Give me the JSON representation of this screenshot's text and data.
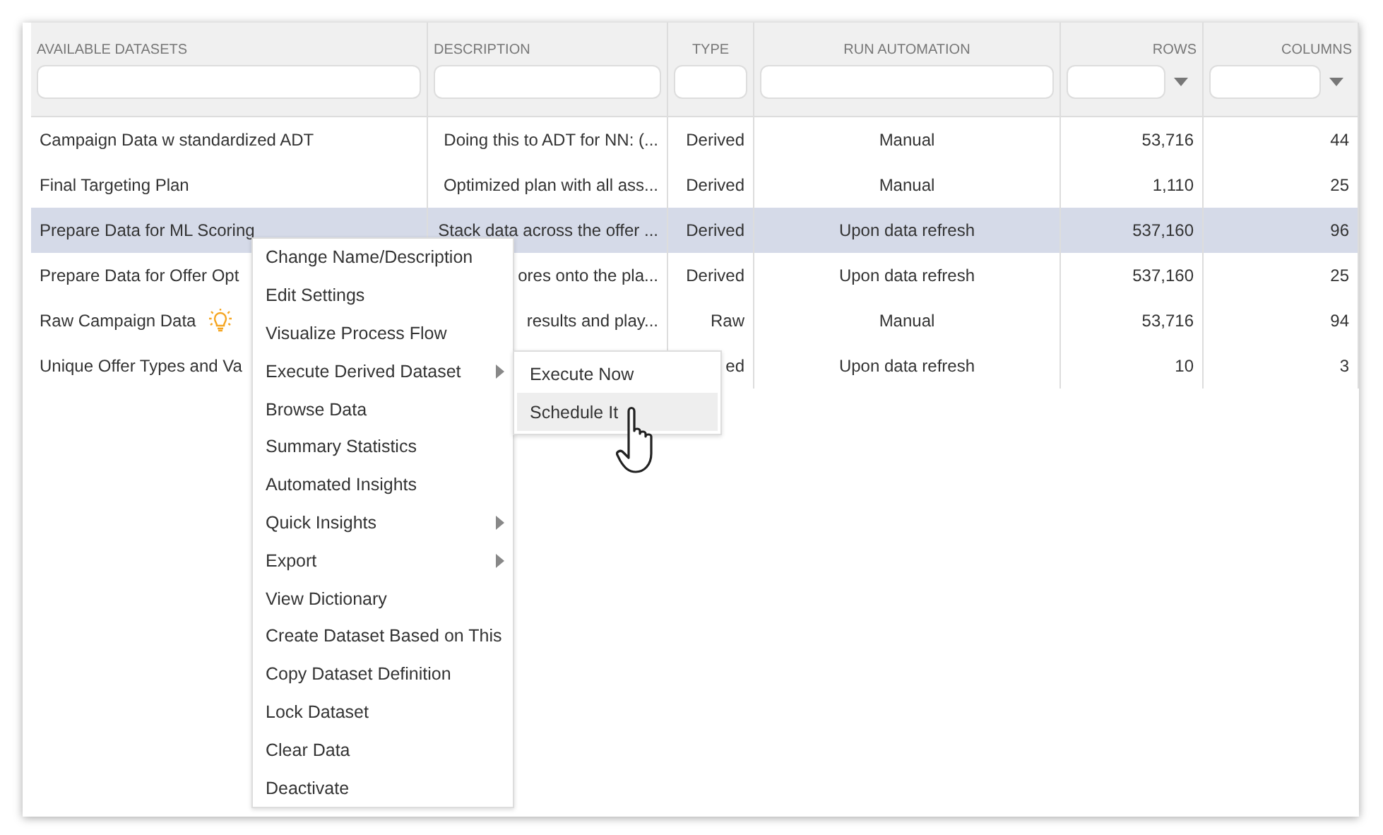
{
  "table": {
    "columns": [
      {
        "label": "AVAILABLE DATASETS",
        "dropdown": false
      },
      {
        "label": "DESCRIPTION",
        "dropdown": false
      },
      {
        "label": "TYPE",
        "dropdown": false
      },
      {
        "label": "RUN AUTOMATION",
        "dropdown": false
      },
      {
        "label": "ROWS",
        "dropdown": true
      },
      {
        "label": "COLUMNS",
        "dropdown": true
      }
    ],
    "rows": [
      {
        "selected": false,
        "insight": false,
        "cells": [
          "Campaign Data w standardized ADT",
          "Doing this to ADT for NN: (...",
          "Derived",
          "Manual",
          "53,716",
          "44"
        ]
      },
      {
        "selected": false,
        "insight": false,
        "cells": [
          "Final Targeting Plan",
          "Optimized plan with all ass...",
          "Derived",
          "Manual",
          "1,110",
          "25"
        ]
      },
      {
        "selected": true,
        "insight": false,
        "cells": [
          "Prepare Data for ML Scoring",
          "Stack data across the offer ...",
          "Derived",
          "Upon data refresh",
          "537,160",
          "96"
        ]
      },
      {
        "selected": false,
        "insight": false,
        "cells": [
          "Prepare Data for Offer Opt",
          "ores onto the pla...",
          "Derived",
          "Upon data refresh",
          "537,160",
          "25"
        ]
      },
      {
        "selected": false,
        "insight": true,
        "cells": [
          "Raw Campaign Data",
          "results and play...",
          "Raw",
          "Manual",
          "53,716",
          "94"
        ]
      },
      {
        "selected": false,
        "insight": false,
        "cells": [
          "Unique Offer Types and Va",
          null,
          "ed",
          "Upon data refresh",
          "10",
          "3"
        ]
      }
    ]
  },
  "context_menu": {
    "items": [
      {
        "label": "Change Name/Description",
        "submenu": false
      },
      {
        "label": "Edit Settings",
        "submenu": false
      },
      {
        "label": "Visualize Process Flow",
        "submenu": false
      },
      {
        "label": "Execute Derived Dataset",
        "submenu": true
      },
      {
        "label": "Browse Data",
        "submenu": false
      },
      {
        "label": "Summary Statistics",
        "submenu": false
      },
      {
        "label": "Automated Insights",
        "submenu": false
      },
      {
        "label": "Quick Insights",
        "submenu": true
      },
      {
        "label": "Export",
        "submenu": true
      },
      {
        "label": "View Dictionary",
        "submenu": false
      },
      {
        "label": "Create Dataset Based on This",
        "submenu": false
      },
      {
        "label": "Copy Dataset Definition",
        "submenu": false
      },
      {
        "label": "Lock Dataset",
        "submenu": false
      },
      {
        "label": "Clear Data",
        "submenu": false
      },
      {
        "label": "Deactivate",
        "submenu": false
      }
    ]
  },
  "submenu": {
    "items": [
      {
        "label": "Execute Now",
        "selected": false
      },
      {
        "label": "Schedule It",
        "selected": true
      }
    ]
  }
}
